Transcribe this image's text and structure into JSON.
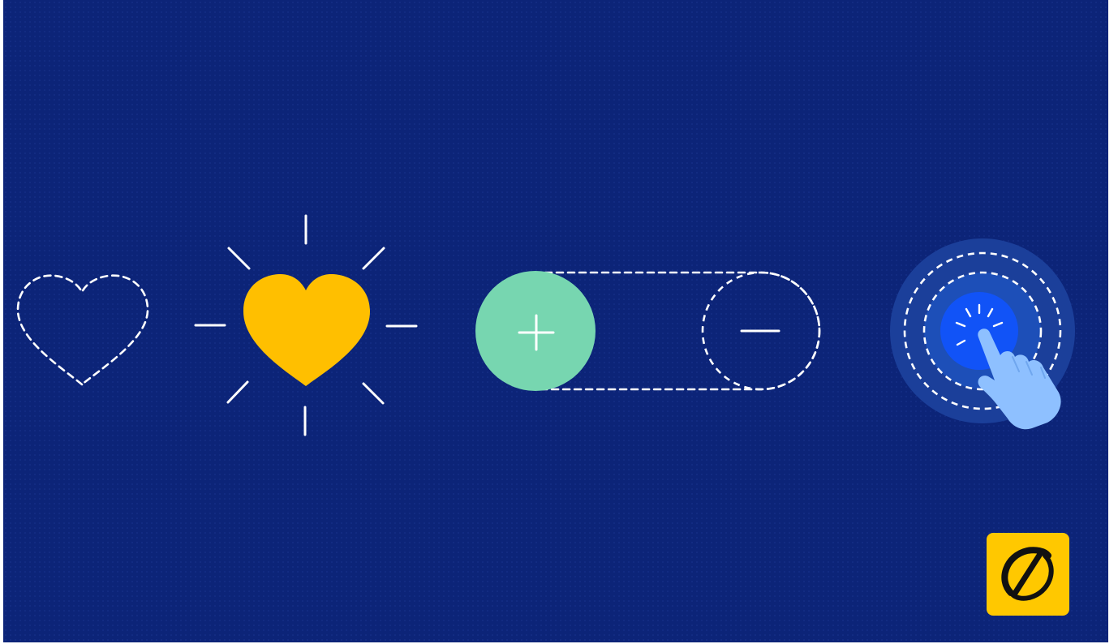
{
  "palette": {
    "background": "#0c2478",
    "dot_pattern": "#15308a",
    "dashed_outline": "#ffffff",
    "heart_fill": "#ffbf00",
    "toggle_knob": "#77d6b0",
    "ripple_outer": "#1b3f9a",
    "ripple_inner": "#1d4fb8",
    "button_core": "#1153f7",
    "hand_fill": "#8ec0ff",
    "logo_tile": "#ffc800",
    "logo_mark": "#111111"
  },
  "illustrations": [
    {
      "name": "heart-outline-icon",
      "state": "unliked"
    },
    {
      "name": "heart-filled-icon",
      "state": "liked"
    },
    {
      "name": "toggle-switch",
      "knob_icon": "plus-icon",
      "off_icon": "minus-icon"
    },
    {
      "name": "tap-button",
      "icon": "pointing-hand-icon"
    }
  ],
  "brand": {
    "logo": "yellow-tile-logo"
  }
}
